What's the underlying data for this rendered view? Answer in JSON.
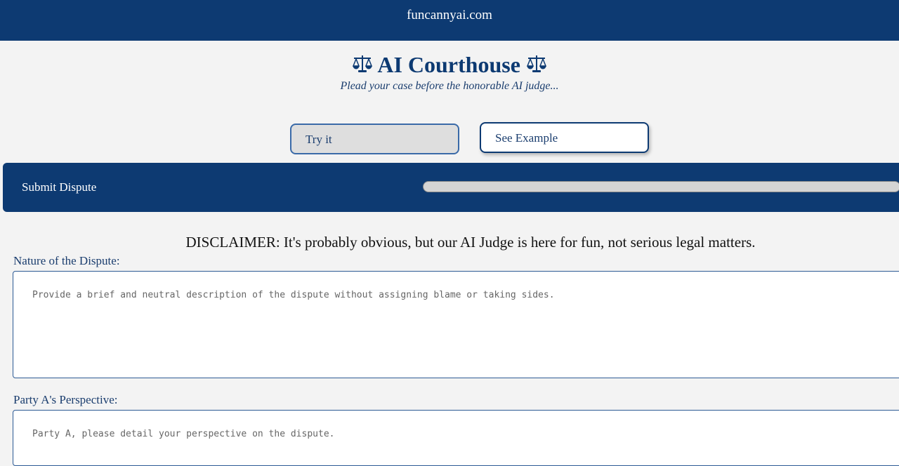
{
  "header": {
    "site_name": "funcannyai.com"
  },
  "hero": {
    "title": "AI Courthouse",
    "title_icon": "scales-icon",
    "subtitle": "Plead your case before the honorable AI judge..."
  },
  "actions": {
    "try_it_label": "Try it",
    "see_example_label": "See Example"
  },
  "submit": {
    "label": "Submit Dispute",
    "progress": 0
  },
  "disclaimer": "DISCLAIMER: It's probably obvious, but our AI Judge is here for fun, not serious legal matters.",
  "form": {
    "fields": [
      {
        "label": "Nature of the Dispute:",
        "placeholder": "Provide a brief and neutral description of the dispute without assigning blame or taking sides.",
        "value": ""
      },
      {
        "label": "Party A's Perspective:",
        "placeholder": "Party A, please detail your perspective on the dispute.",
        "value": ""
      }
    ]
  },
  "colors": {
    "primary": "#0d3a72",
    "background": "#f3f3f3",
    "accent_text": "#1a3d6e"
  }
}
